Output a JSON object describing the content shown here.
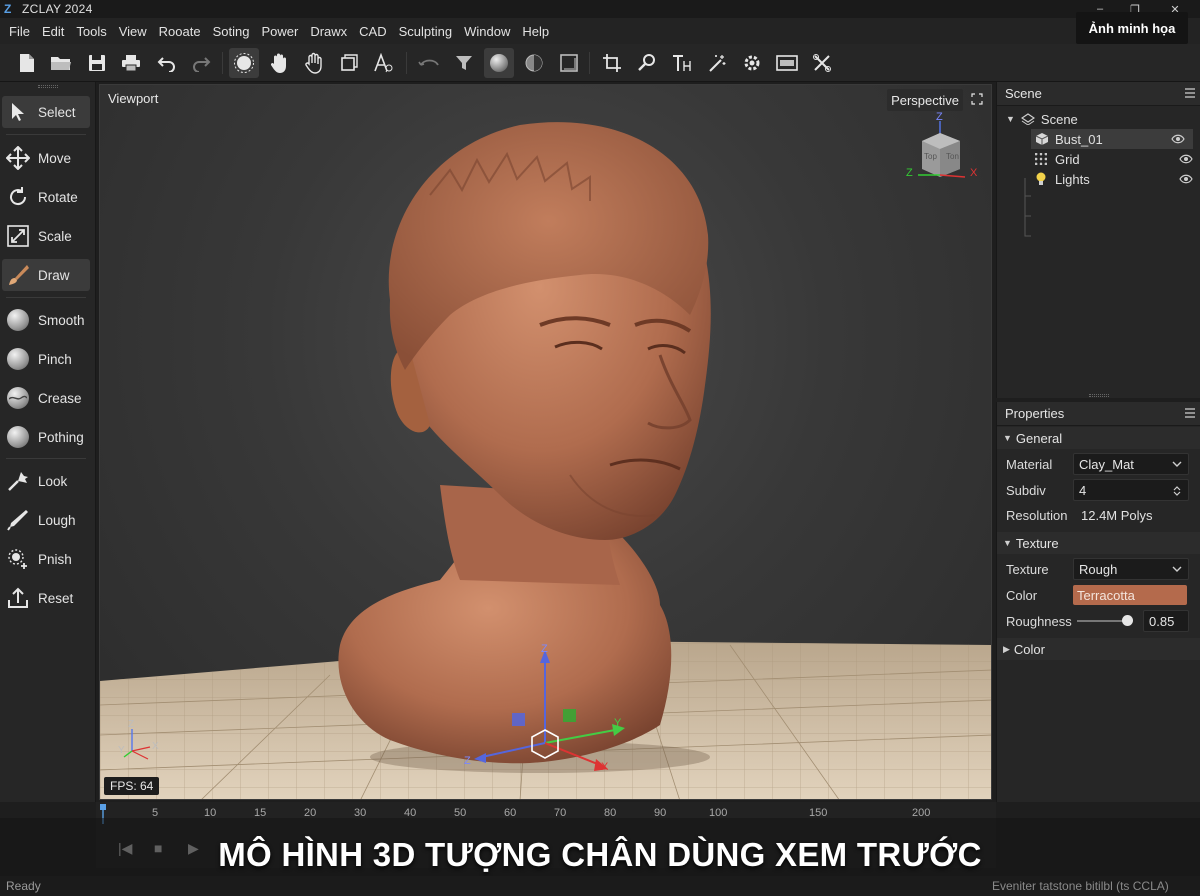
{
  "app": {
    "logo": "Z",
    "title": "ZCLAY 2024"
  },
  "window_controls": {
    "minimize": "–",
    "restore": "❐",
    "close": "✕"
  },
  "badge": "Ảnh minh họa",
  "menu": [
    "File",
    "Edit",
    "Tools",
    "View",
    "Rooate",
    "Soting",
    "Power",
    "Drawx",
    "CAD",
    "Sculpting",
    "Window",
    "Help"
  ],
  "toolbar": {
    "icons": [
      "new-file-icon",
      "open-folder-icon",
      "save-icon",
      "print-icon",
      "undo-icon",
      "redo-icon",
      "sculpt-brush-icon",
      "hand-icon",
      "grab-hand-icon",
      "transform-box-icon",
      "text-node-icon",
      "lasso-icon",
      "filter-icon",
      "sphere-shade-icon",
      "half-shade-icon",
      "frame-icon",
      "crop-icon",
      "search-icon",
      "text-height-icon",
      "magic-wand-icon",
      "gear-icon",
      "render-icon",
      "tools-icon"
    ]
  },
  "tools": [
    {
      "label": "Select",
      "icon": "cursor-icon",
      "active": true
    },
    {
      "label": "Move",
      "icon": "move-arrows-icon"
    },
    {
      "label": "Rotate",
      "icon": "rotate-icon"
    },
    {
      "label": "Scale",
      "icon": "scale-icon"
    },
    {
      "label": "Draw",
      "icon": "brush-icon",
      "active": true
    },
    {
      "label": "Smooth",
      "icon": "smooth-ball-icon"
    },
    {
      "label": "Pinch",
      "icon": "pinch-ball-icon"
    },
    {
      "label": "Crease",
      "icon": "crease-ball-icon"
    },
    {
      "label": "Pothing",
      "icon": "pothing-ball-icon"
    },
    {
      "label": "Look",
      "icon": "look-tool-icon"
    },
    {
      "label": "Lough",
      "icon": "pen-icon"
    },
    {
      "label": "Pnish",
      "icon": "pnish-icon"
    },
    {
      "label": "Reset",
      "icon": "reset-icon"
    }
  ],
  "viewport": {
    "label": "Viewport",
    "projection": "Perspective",
    "fps": "FPS: 64",
    "view_cube": {
      "z": "Z",
      "x": "X",
      "face1": "Top",
      "face2": "Ton"
    },
    "gizmo_labels": {
      "z": "Z",
      "x": "X",
      "y": "Y",
      "neg_z": "Z"
    },
    "colors": {
      "clay": "#b87456",
      "floor": "#d9c8b0"
    }
  },
  "scene": {
    "title": "Scene",
    "tree": [
      {
        "label": "Scene",
        "icon": "scene-icon"
      },
      {
        "label": "Bust_01",
        "icon": "cube-icon",
        "selected": true
      },
      {
        "label": "Grid",
        "icon": "grid-icon"
      },
      {
        "label": "Lights",
        "icon": "bulb-icon"
      }
    ]
  },
  "properties": {
    "title": "Properties",
    "general": {
      "header": "General",
      "material_label": "Material",
      "material_value": "Clay_Mat",
      "subdiv_label": "Subdiv",
      "subdiv_value": "4",
      "resolution_label": "Resolution",
      "resolution_value": "12.4M Polys"
    },
    "texture": {
      "header": "Texture",
      "texture_label": "Texture",
      "texture_value": "Rough",
      "color_label": "Color",
      "color_value": "Terracotta",
      "color_hex": "#b46a4c",
      "roughness_label": "Roughness",
      "roughness_value": "0.85"
    },
    "color_section": {
      "header": "Color"
    }
  },
  "timeline": {
    "ticks": [
      "5",
      "10",
      "15",
      "20",
      "30",
      "40",
      "50",
      "60",
      "70",
      "80",
      "90",
      "100",
      "150",
      "200"
    ],
    "controls": {
      "start": "|◀",
      "stop": "■",
      "play": "▶"
    }
  },
  "status": {
    "left": "Ready",
    "right": "Eveniter tatstone bitilbl (ts CCLA)"
  },
  "caption": "MÔ HÌNH 3D TƯỢNG CHÂN DÙNG XEM TRƯỚC"
}
